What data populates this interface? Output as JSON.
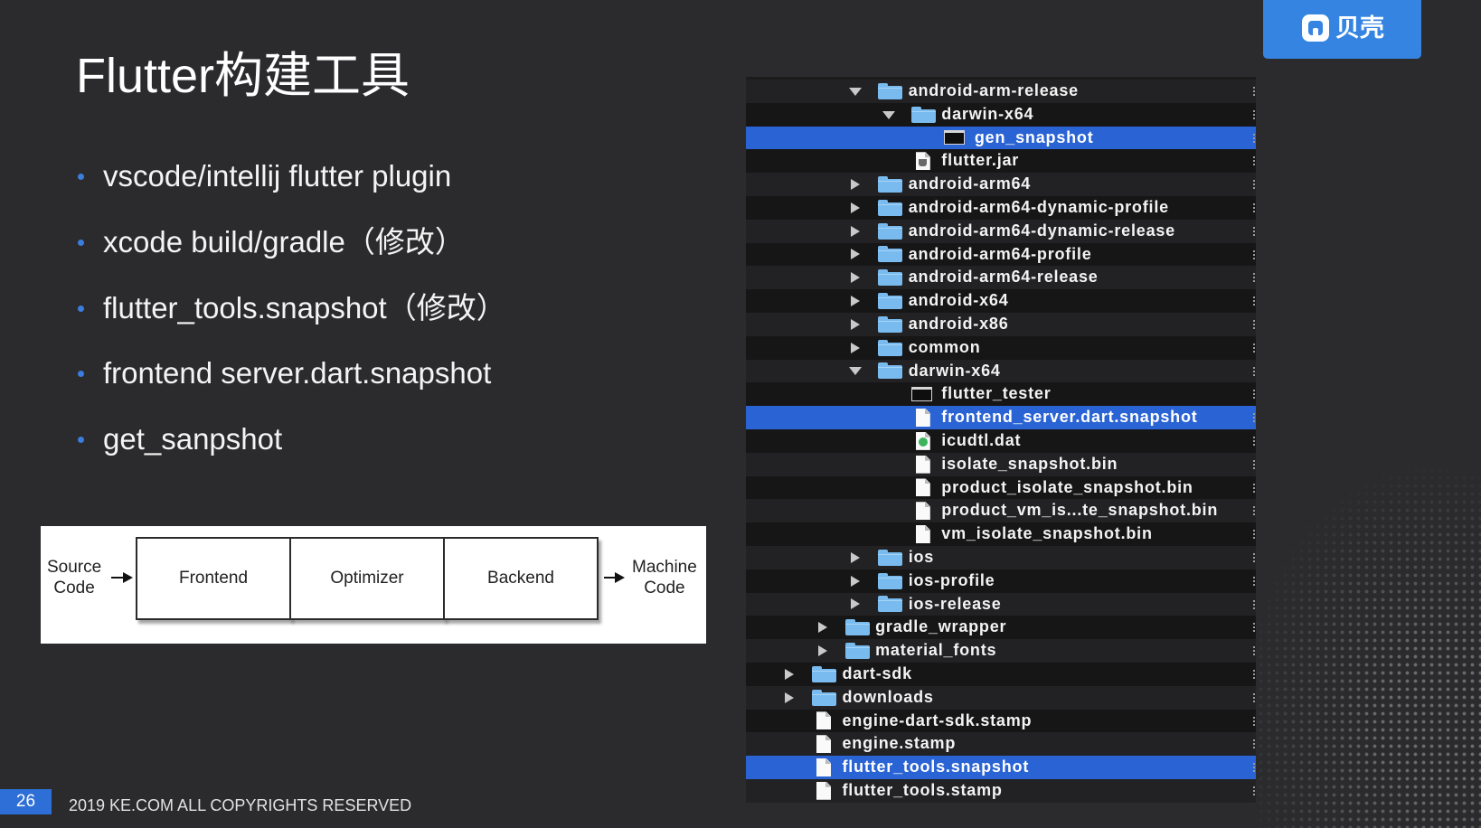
{
  "slide": {
    "title": "Flutter构建工具",
    "bullets": [
      "vscode/intellij flutter plugin",
      "xcode build/gradle（修改）",
      "flutter_tools.snapshot（修改）",
      "frontend server.dart.snapshot",
      "get_sanpshot"
    ],
    "page_number": "26",
    "copyright": "2019 KE.COM ALL COPYRIGHTS RESERVED"
  },
  "logo": {
    "text": "贝壳",
    "icon": "beike-logo-icon"
  },
  "diagram": {
    "input": "Source Code",
    "stages": [
      "Frontend",
      "Optimizer",
      "Backend"
    ],
    "output": "Machine Code"
  },
  "file_tree": {
    "rows": [
      {
        "name": "android-arm-release",
        "depth": 3,
        "kind": "folder",
        "expanded": true,
        "selected": false
      },
      {
        "name": "darwin-x64",
        "depth": 4,
        "kind": "folder",
        "expanded": true,
        "selected": false
      },
      {
        "name": "gen_snapshot",
        "depth": 5,
        "kind": "executable",
        "selected": true
      },
      {
        "name": "flutter.jar",
        "depth": 4,
        "kind": "jar",
        "selected": false
      },
      {
        "name": "android-arm64",
        "depth": 3,
        "kind": "folder",
        "expanded": false,
        "selected": false
      },
      {
        "name": "android-arm64-dynamic-profile",
        "depth": 3,
        "kind": "folder",
        "expanded": false,
        "selected": false
      },
      {
        "name": "android-arm64-dynamic-release",
        "depth": 3,
        "kind": "folder",
        "expanded": false,
        "selected": false
      },
      {
        "name": "android-arm64-profile",
        "depth": 3,
        "kind": "folder",
        "expanded": false,
        "selected": false
      },
      {
        "name": "android-arm64-release",
        "depth": 3,
        "kind": "folder",
        "expanded": false,
        "selected": false
      },
      {
        "name": "android-x64",
        "depth": 3,
        "kind": "folder",
        "expanded": false,
        "selected": false
      },
      {
        "name": "android-x86",
        "depth": 3,
        "kind": "folder",
        "expanded": false,
        "selected": false
      },
      {
        "name": "common",
        "depth": 3,
        "kind": "folder",
        "expanded": false,
        "selected": false
      },
      {
        "name": "darwin-x64",
        "depth": 3,
        "kind": "folder",
        "expanded": true,
        "selected": false
      },
      {
        "name": "flutter_tester",
        "depth": 4,
        "kind": "executable",
        "selected": false
      },
      {
        "name": "frontend_server.dart.snapshot",
        "depth": 4,
        "kind": "document",
        "selected": true
      },
      {
        "name": "icudtl.dat",
        "depth": 4,
        "kind": "data",
        "selected": false
      },
      {
        "name": "isolate_snapshot.bin",
        "depth": 4,
        "kind": "document",
        "selected": false
      },
      {
        "name": "product_isolate_snapshot.bin",
        "depth": 4,
        "kind": "document",
        "selected": false
      },
      {
        "name": "product_vm_is...te_snapshot.bin",
        "depth": 4,
        "kind": "document",
        "selected": false
      },
      {
        "name": "vm_isolate_snapshot.bin",
        "depth": 4,
        "kind": "document",
        "selected": false
      },
      {
        "name": "ios",
        "depth": 3,
        "kind": "folder",
        "expanded": false,
        "selected": false
      },
      {
        "name": "ios-profile",
        "depth": 3,
        "kind": "folder",
        "expanded": false,
        "selected": false
      },
      {
        "name": "ios-release",
        "depth": 3,
        "kind": "folder",
        "expanded": false,
        "selected": false
      },
      {
        "name": "gradle_wrapper",
        "depth": 2,
        "kind": "folder",
        "expanded": false,
        "selected": false
      },
      {
        "name": "material_fonts",
        "depth": 2,
        "kind": "folder",
        "expanded": false,
        "selected": false
      },
      {
        "name": "dart-sdk",
        "depth": 1,
        "kind": "folder",
        "expanded": false,
        "selected": false
      },
      {
        "name": "downloads",
        "depth": 1,
        "kind": "folder",
        "expanded": false,
        "selected": false
      },
      {
        "name": "engine-dart-sdk.stamp",
        "depth": 1,
        "kind": "document",
        "selected": false
      },
      {
        "name": "engine.stamp",
        "depth": 1,
        "kind": "document",
        "selected": false
      },
      {
        "name": "flutter_tools.snapshot",
        "depth": 1,
        "kind": "document",
        "selected": true
      },
      {
        "name": "flutter_tools.stamp",
        "depth": 1,
        "kind": "document",
        "selected": false
      }
    ]
  },
  "colors": {
    "background": "#2b2b2e",
    "accent": "#2d6fd6",
    "bullet": "#3b7ddd",
    "selection": "#2a63d4",
    "folder": "#79bbef",
    "logo": "#3584e2"
  }
}
